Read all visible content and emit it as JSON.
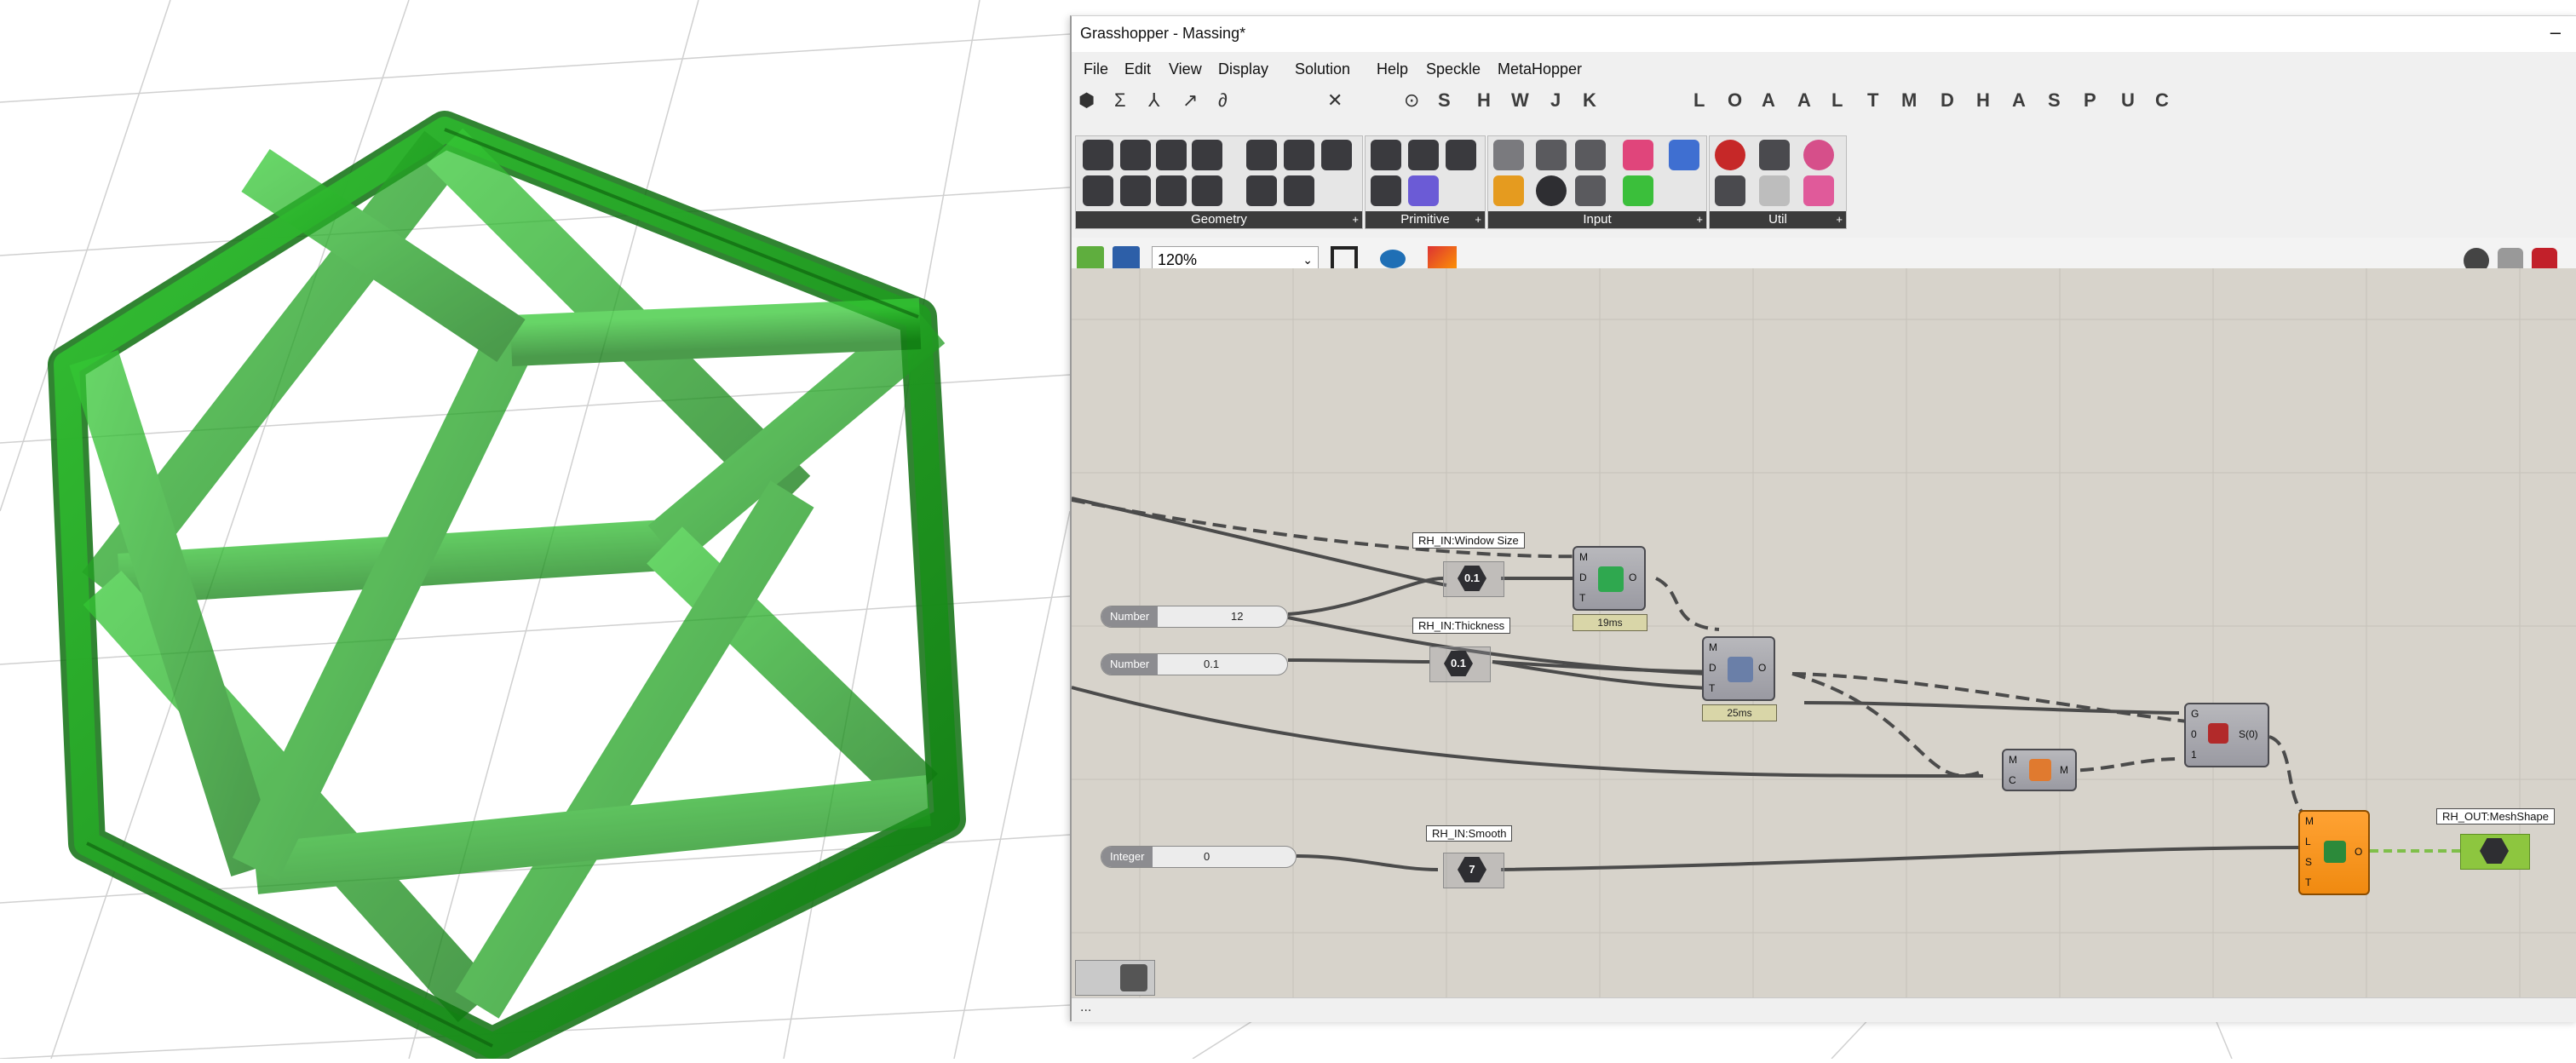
{
  "window": {
    "title": "Grasshopper - Massing*",
    "minimize_glyph": "–"
  },
  "menu": [
    "File",
    "Edit",
    "View",
    "Display",
    "Solution",
    "Help",
    "Speckle",
    "MetaHopper"
  ],
  "tabs": {
    "symbols": [
      "Σ",
      "⅄",
      "↗",
      "∂",
      "✕",
      "⊙"
    ],
    "letters": [
      "S",
      "H",
      "W",
      "J",
      "K",
      "L",
      "O",
      "A",
      "A",
      "L",
      "T",
      "M",
      "D",
      "H",
      "A",
      "S",
      "P",
      "U",
      "C"
    ]
  },
  "ribbon": {
    "panels": [
      {
        "label": "Geometry",
        "expand": "+"
      },
      {
        "label": "Primitive",
        "expand": "+"
      },
      {
        "label": "Input",
        "expand": "+"
      },
      {
        "label": "Util",
        "expand": "+"
      }
    ]
  },
  "canvas_toolbar": {
    "zoom": "120%"
  },
  "nodes": {
    "tag_window_size": "RH_IN:Window Size",
    "tag_thickness": "RH_IN:Thickness",
    "tag_smooth": "RH_IN:Smooth",
    "tag_meshshape": "RH_OUT:MeshShape",
    "slider_number_1": {
      "label": "Number",
      "value": "12"
    },
    "slider_number_2": {
      "label": "Number",
      "value": "0.1"
    },
    "slider_integer": {
      "label": "Integer",
      "value": "0"
    },
    "time_1": "19ms",
    "time_2": "25ms",
    "param_label_1": "0.1",
    "param_label_2": "0.1",
    "param_label_3": "7",
    "pins_comp1": [
      "M",
      "D",
      "T",
      "O"
    ],
    "pins_comp2": [
      "M",
      "D",
      "T",
      "O"
    ],
    "pins_comp3": [
      "M",
      "C",
      "M"
    ],
    "pins_comp4": [
      "G",
      "0",
      "1",
      "S(0)"
    ],
    "pins_comp5": [
      "M",
      "L",
      "S",
      "T",
      "O"
    ]
  },
  "statusbar": {
    "text": "..."
  },
  "colors": {
    "mesh_green": "#1f9e1f",
    "canvas_bg": "#d7d3cb",
    "output_orange": "#f7941d",
    "output_param_green": "#8dc63f"
  }
}
